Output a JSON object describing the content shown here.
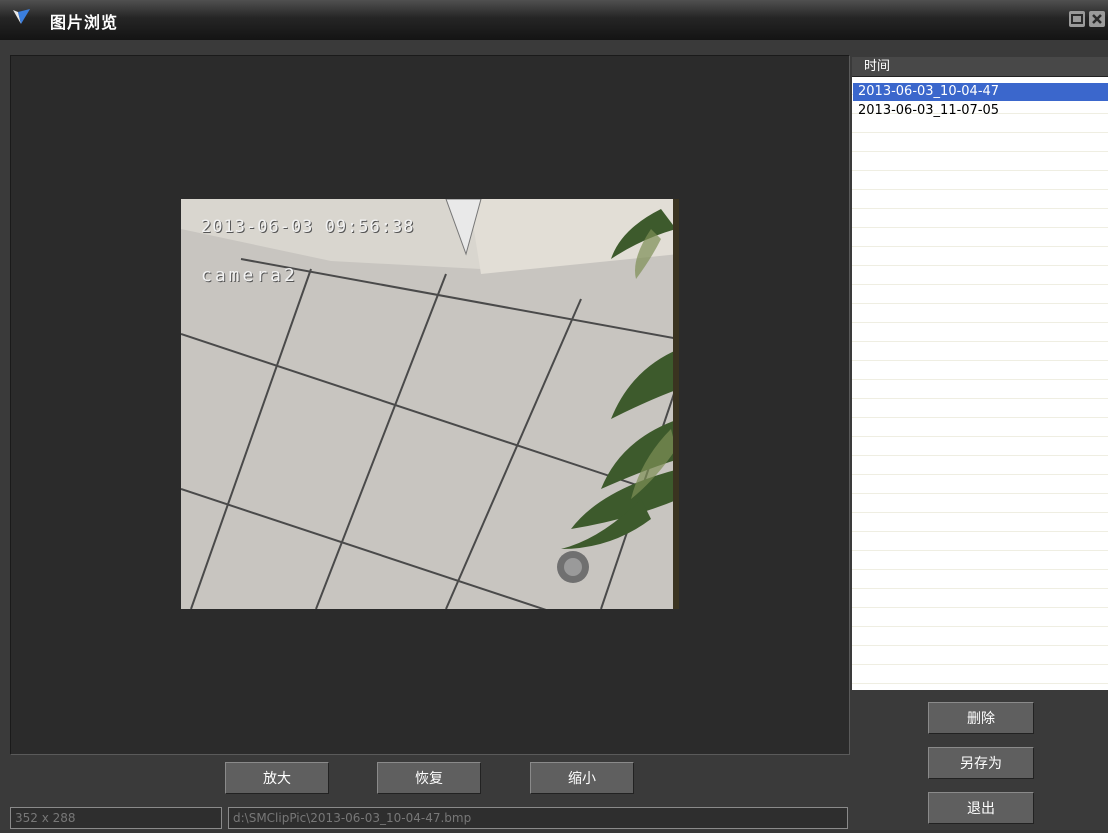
{
  "window": {
    "title": "图片浏览",
    "icon": "app-logo-icon",
    "controls": [
      "maximize-icon",
      "close-icon"
    ]
  },
  "snapshot": {
    "overlay_timestamp": "2013-06-03 09:56:38",
    "overlay_camera": "camera2"
  },
  "viewer_buttons": {
    "zoom_in": "放大",
    "restore": "恢复",
    "zoom_out": "缩小"
  },
  "file_list": {
    "column_header": "时间",
    "items": [
      {
        "label": "2013-06-03_10-04-47",
        "selected": true
      },
      {
        "label": "2013-06-03_11-07-05",
        "selected": false
      }
    ],
    "selection_color": "#3b67cc"
  },
  "side_buttons": {
    "delete": "删除",
    "save_as": "另存为",
    "exit": "退出"
  },
  "status_bar": {
    "image_size": "352 x 288",
    "file_path": "d:\\SMClipPic\\2013-06-03_10-04-47.bmp"
  }
}
